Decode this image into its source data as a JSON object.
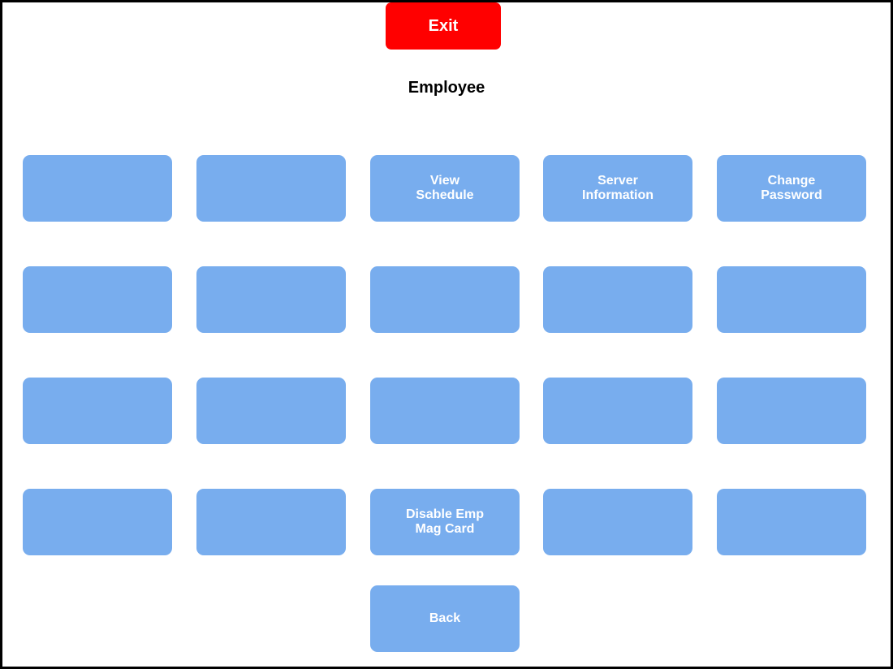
{
  "header": {
    "exit_label": "Exit",
    "title": "Employee"
  },
  "grid": {
    "rows": [
      [
        "",
        "",
        "View\nSchedule",
        "Server\nInformation",
        "Change\nPassword"
      ],
      [
        "",
        "",
        "",
        "",
        ""
      ],
      [
        "",
        "",
        "",
        "",
        ""
      ],
      [
        "",
        "",
        "Disable Emp\nMag Card",
        "",
        ""
      ]
    ]
  },
  "footer": {
    "back_label": "Back"
  },
  "colors": {
    "exit": "#ff0000",
    "button": "#78adee",
    "button_text": "#ffffff"
  }
}
